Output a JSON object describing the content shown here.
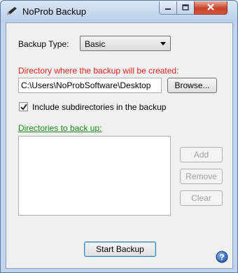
{
  "window": {
    "title": "NoProb Backup",
    "controls": {
      "minimize": "minimize-icon",
      "maximize": "maximize-icon",
      "close": "close-icon"
    }
  },
  "form": {
    "backup_type_label": "Backup Type:",
    "backup_type_value": "Basic",
    "directory_label": "Directory where the backup will be created:",
    "directory_value": "C:\\Users\\NoProbSoftware\\Desktop",
    "browse_label": "Browse...",
    "include_subdirs_label": "Include subdirectories in the backup",
    "include_subdirs_checked": true,
    "dirs_label": "Directories to back up:",
    "dirs_list": [],
    "add_label": "Add",
    "remove_label": "Remove",
    "clear_label": "Clear",
    "start_label": "Start Backup"
  },
  "colors": {
    "directory_label": "#e02020",
    "dirs_label": "#1b8a1b",
    "title_bar": "#bfd4ec"
  }
}
